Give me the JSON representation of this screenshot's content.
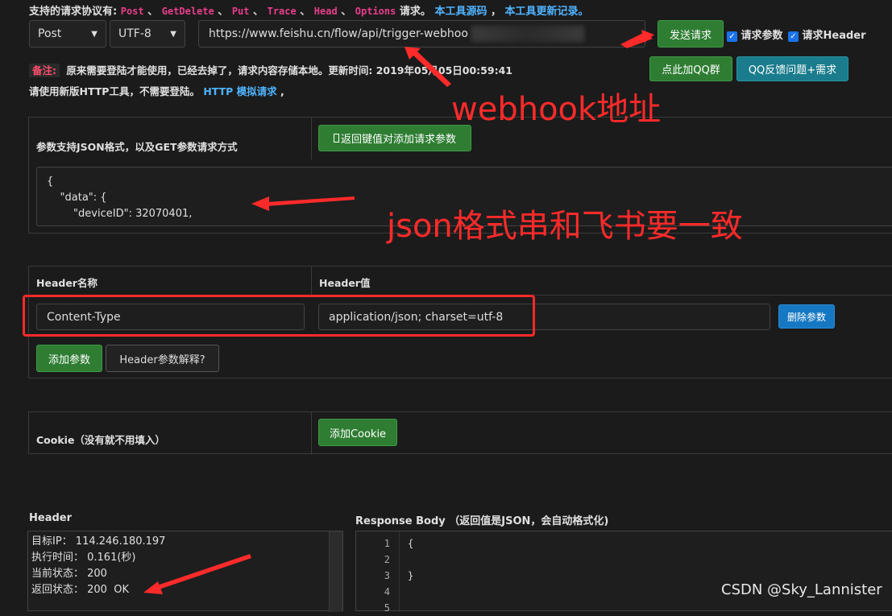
{
  "header": {
    "protocols_label": "支持的请求协议有:",
    "protocols": [
      "Post",
      "GetDelete",
      "Put",
      "Trace",
      "Head",
      "Options"
    ],
    "separator": "、",
    "protocols_suffix": "请求。",
    "source_link": "本工具源码",
    "comma": "，",
    "changelog_link": "本工具更新记录。"
  },
  "request": {
    "method": "Post",
    "encoding": "UTF-8",
    "url": "https://www.feishu.cn/flow/api/trigger-webhoo",
    "send_label": "发送请求",
    "param_checkbox_label": "请求参数",
    "header_checkbox_label": "请求Header"
  },
  "notice": {
    "tag": "备注:",
    "text": "原来需要登陆才能使用，已经去掉了，请求内容存储本地。更新时间: 2019年05月05日00:59:41",
    "line2_prefix": "请使用新版HTTP工具，不需要登陆。",
    "line2_link": "HTTP 模拟请求",
    "line2_suffix": ","
  },
  "qq": {
    "join_group": "点此加QQ群",
    "feedback": "QQ反馈问题+需求"
  },
  "params": {
    "title": "参数支持JSON格式，以及GET参数请求方式",
    "back_button": "返回键值对添加请求参数",
    "json_lines": [
      "{",
      "    \"data\": {",
      "        \"deviceID\": 32070401,"
    ]
  },
  "headers": {
    "col_name": "Header名称",
    "col_value": "Header值",
    "row_name": "Content-Type",
    "row_value": "application/json; charset=utf-8",
    "delete_button": "删除参数",
    "add_button": "添加参数",
    "explain_button": "Header参数解释?"
  },
  "cookie": {
    "title": "Cookie（没有就不用填入）",
    "add_button": "添加Cookie"
  },
  "response_header": {
    "title": "Header",
    "lines": [
      "目标IP： 114.246.180.197",
      "执行时间： 0.161(秒)",
      "当前状态： 200",
      "返回状态： 200  OK"
    ]
  },
  "response_body": {
    "title": "Response Body",
    "subtitle": "（返回值是JSON，会自动格式化)",
    "line_numbers": [
      "1",
      "2",
      "3",
      "4",
      "5"
    ],
    "lines": [
      "{",
      "",
      "}",
      "",
      ""
    ]
  },
  "annotations": {
    "webhook": "webhook地址",
    "json_note": "json格式串和飞书要一致"
  },
  "watermark": "CSDN @Sky_Lannister",
  "colors": {
    "annotation_red": "#ff2a2a",
    "button_green": "#2e7d32",
    "button_teal": "#1a7c8c",
    "button_blue": "#1678c2",
    "link_blue": "#4fb3ff",
    "protocol_pink": "#e83e8c"
  }
}
